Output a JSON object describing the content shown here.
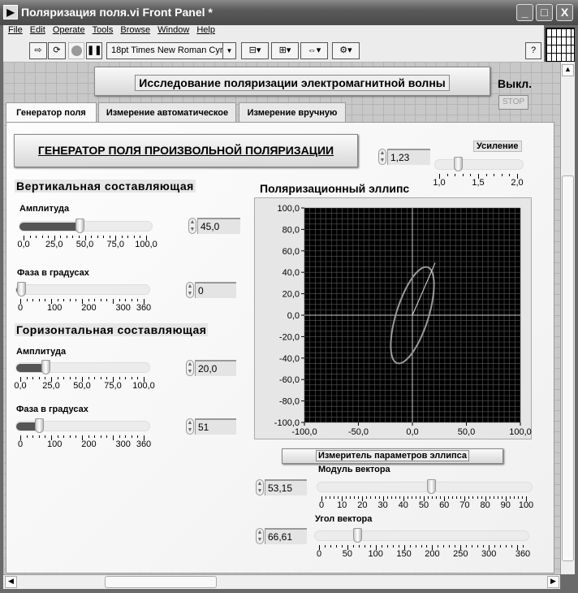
{
  "window": {
    "title": "Поляризация поля.vi Front Panel *",
    "minimize": "_",
    "maximize": "□",
    "close": "X"
  },
  "menu": [
    "File",
    "Edit",
    "Operate",
    "Tools",
    "Browse",
    "Window",
    "Help"
  ],
  "toolbar": {
    "font_select": "18pt Times New Roman Cyr",
    "help": "?"
  },
  "header": {
    "main_button": "Исследование поляризации электромагнитной волны",
    "off_label": "Выкл.",
    "stop_button": "STOP"
  },
  "tabs": [
    "Генератор поля",
    "Измерение автоматическое",
    "Измерение вручную"
  ],
  "generator": {
    "title_button": "ГЕНЕРАТОР ПОЛЯ ПРОИЗВОЛЬНОЙ ПОЛЯРИЗАЦИИ",
    "gain": {
      "label": "Усиление",
      "value": "1,23",
      "numeric": 1.23,
      "min": 1.0,
      "max": 2.0,
      "ticks": [
        "1,0",
        "1,5",
        "2,0"
      ]
    },
    "vertical": {
      "title": "Вертикальная составляющая",
      "amplitude": {
        "label": "Амплитуда",
        "value": "45,0",
        "numeric": 45,
        "max": 100,
        "ticks": [
          "0,0",
          "25,0",
          "50,0",
          "75,0",
          "100,0"
        ]
      },
      "phase": {
        "label": "Фаза в градусах",
        "value": "0",
        "numeric": 0,
        "max": 360,
        "ticks": [
          "0",
          "100",
          "200",
          "300",
          "360"
        ]
      }
    },
    "horizontal": {
      "title": "Горизонтальная составляющая",
      "amplitude": {
        "label": "Амплитуда",
        "value": "20,0",
        "numeric": 20,
        "max": 100,
        "ticks": [
          "0,0",
          "25,0",
          "50,0",
          "75,0",
          "100,0"
        ]
      },
      "phase": {
        "label": "Фаза в градусах",
        "value": "51",
        "numeric": 51,
        "max": 360,
        "ticks": [
          "0",
          "100",
          "200",
          "300",
          "360"
        ]
      }
    }
  },
  "graph": {
    "title": "Поляризационный эллипс",
    "y_ticks": [
      "100,0",
      "80,0",
      "60,0",
      "40,0",
      "20,0",
      "0,0",
      "-20,0",
      "-40,0",
      "-60,0",
      "-80,0",
      "-100,0"
    ],
    "x_ticks": [
      "-100,0",
      "-50,0",
      "0,0",
      "50,0",
      "100,0"
    ],
    "background": "#000000",
    "grid_color": "#5a5a5a",
    "trace_color": "#9a9a9a"
  },
  "meter": {
    "button": "Измеритель параметров эллипса",
    "modulus": {
      "label": "Модуль вектора",
      "value": "53,15",
      "numeric": 53.15,
      "max": 100,
      "ticks": [
        "0",
        "10",
        "20",
        "30",
        "40",
        "50",
        "60",
        "70",
        "80",
        "90",
        "100"
      ]
    },
    "angle": {
      "label": "Угол вектора",
      "value": "66,61",
      "numeric": 66.61,
      "max": 360,
      "ticks": [
        "0",
        "50",
        "100",
        "150",
        "200",
        "250",
        "300",
        "360"
      ]
    }
  }
}
